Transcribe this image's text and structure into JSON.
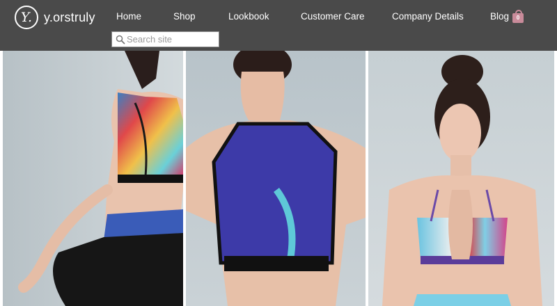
{
  "brand": {
    "logo_mark": "Y.",
    "name": "y.orstruly"
  },
  "nav": {
    "items": [
      {
        "label": "Home"
      },
      {
        "label": "Shop"
      },
      {
        "label": "Lookbook"
      },
      {
        "label": "Customer Care"
      },
      {
        "label": "Company Details"
      },
      {
        "label": "Blog"
      }
    ]
  },
  "cart": {
    "count": "0",
    "icon": "shopping-bag-icon",
    "color": "#c98b9a"
  },
  "search": {
    "placeholder": "Search site",
    "value": "",
    "icon": "search-icon"
  },
  "colors": {
    "header_bg": "#4a4a4a",
    "header_text": "#ffffff",
    "backdrop": "#c3ccd0"
  },
  "gallery": {
    "photos": [
      {
        "subject": "woman in printed sports bra and leggings"
      },
      {
        "subject": "back view of mesh racerback sports bra"
      },
      {
        "subject": "woman in yoga pose with hands together"
      }
    ]
  }
}
